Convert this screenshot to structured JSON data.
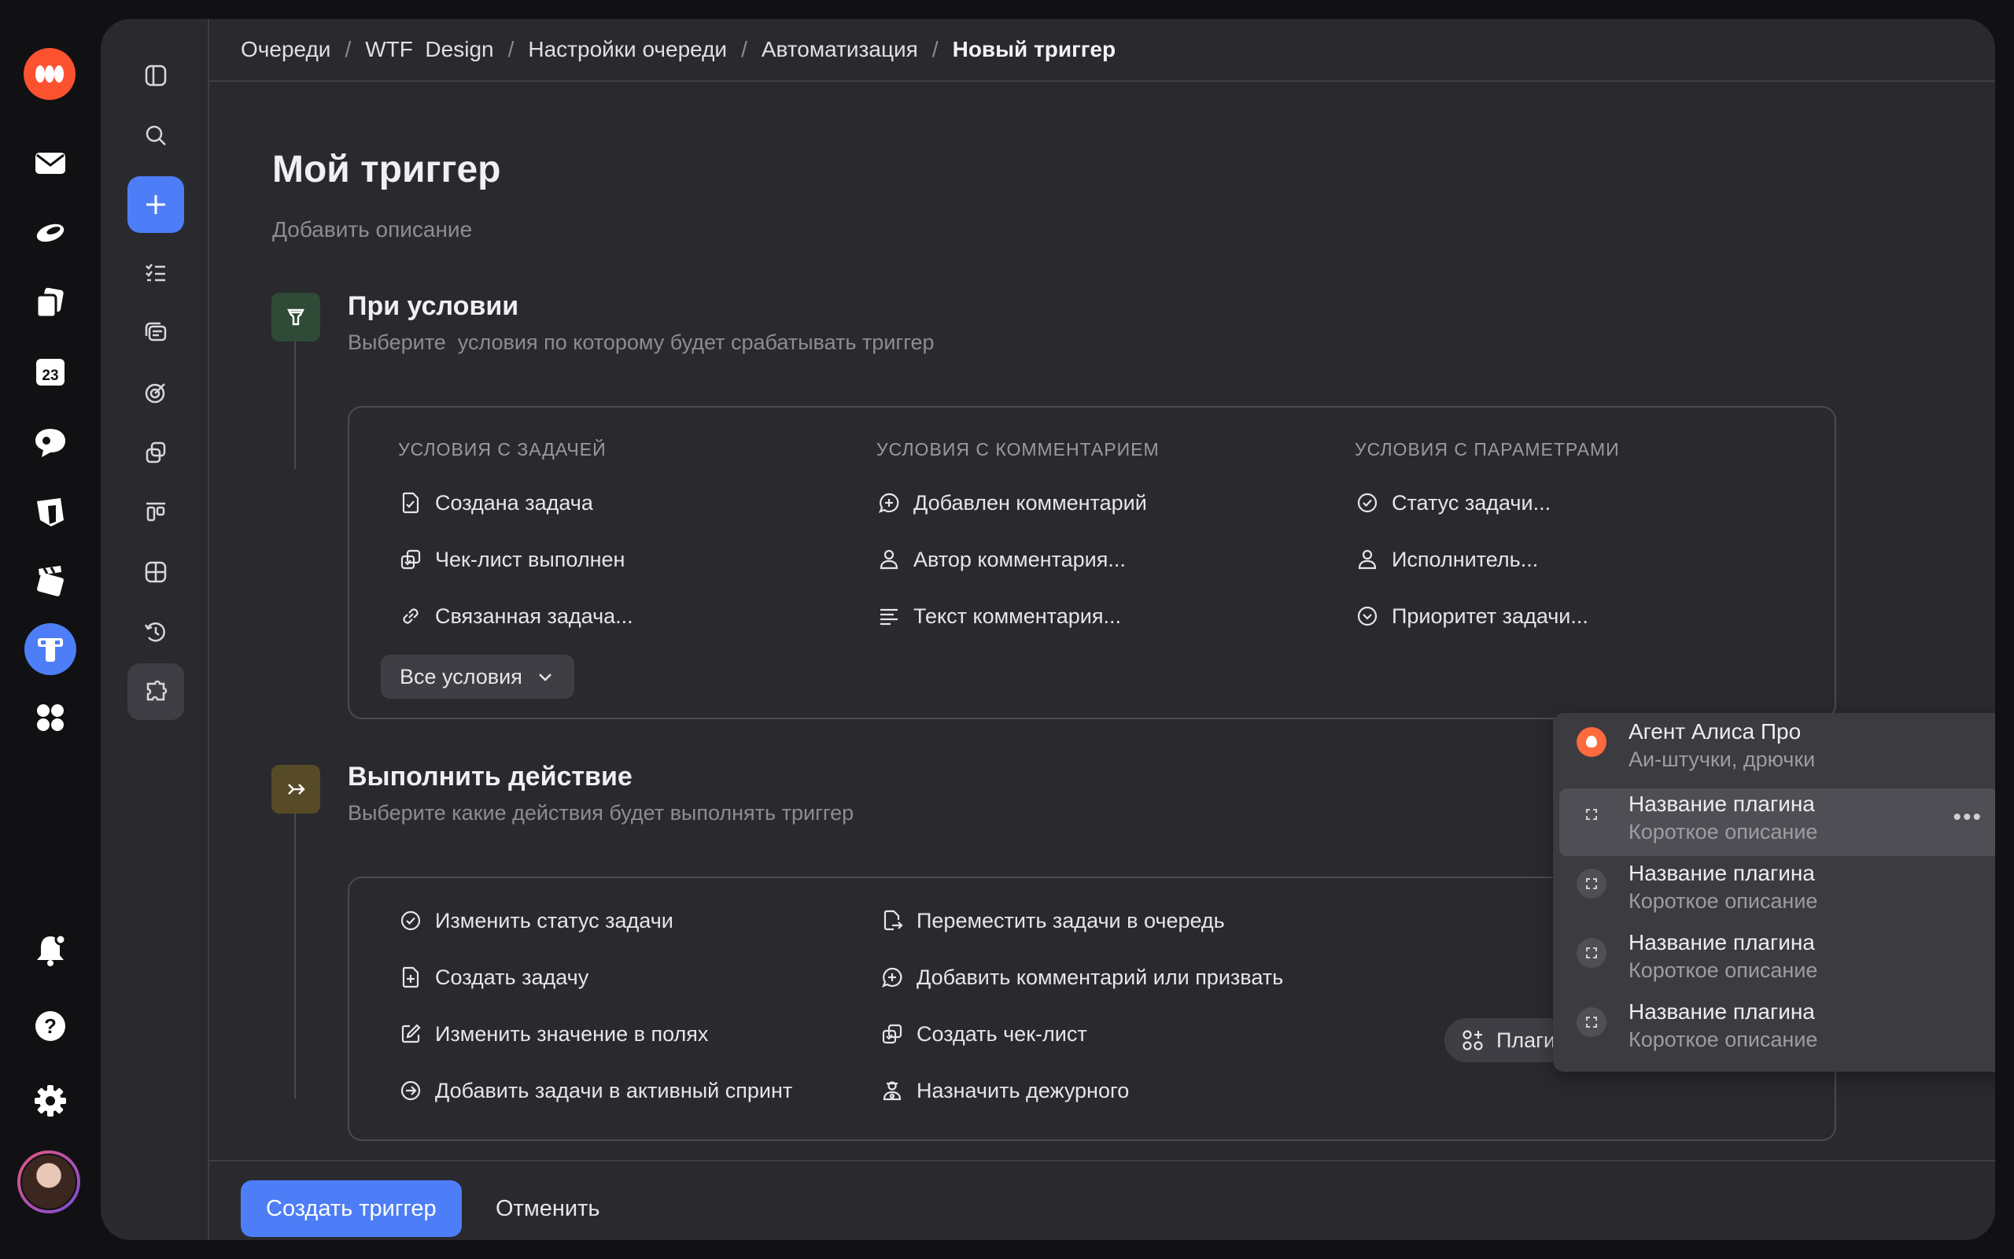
{
  "breadcrumbs": [
    "Очереди",
    "WTF  Design",
    "Настройки очереди",
    "Автоматизация",
    "Новый триггер"
  ],
  "page": {
    "title": "Мой триггер",
    "description_placeholder": "Добавить описание"
  },
  "condition_step": {
    "title": "При условии",
    "subtitle": "Выберите  условия по которому будет срабатывать триггер",
    "columns": [
      {
        "heading": "УСЛОВИЯ С ЗАДАЧЕЙ",
        "items": [
          "Создана задача",
          "Чек-лист выполнен",
          "Связанная задача..."
        ]
      },
      {
        "heading": "УСЛОВИЯ С КОММЕНТАРИЕМ",
        "items": [
          "Добавлен комментарий",
          "Автор комментария...",
          "Текст комментария..."
        ]
      },
      {
        "heading": "УСЛОВИЯ С ПАРАМЕТРАМИ",
        "items": [
          "Статус задачи...",
          "Исполнитель...",
          "Приоритет задачи..."
        ]
      }
    ],
    "all_conditions_label": "Все условия"
  },
  "action_step": {
    "title": "Выполнить действие",
    "subtitle": "Выберите какие действия будет выполнять триггер",
    "columns": [
      {
        "items": [
          "Изменить статус задачи",
          "Создать задачу",
          "Изменить значение в полях",
          "Добавить задачи в активный спринт"
        ]
      },
      {
        "items": [
          "Переместить задачи в очередь",
          "Добавить комментарий или призвать",
          "Создать чек-лист",
          "Назначить дежурного"
        ]
      }
    ],
    "plugins_label": "Плагины"
  },
  "plugins_dropdown": {
    "items": [
      {
        "title": "Агент Алиса Про",
        "subtitle": "Аи-штучки, дрючки"
      },
      {
        "title": "Название плагина",
        "subtitle": "Короткое описание"
      },
      {
        "title": "Название плагина",
        "subtitle": "Короткое описание"
      },
      {
        "title": "Название плагина",
        "subtitle": "Короткое описание"
      },
      {
        "title": "Название плагина",
        "subtitle": "Короткое описание"
      }
    ],
    "more_label": "•••"
  },
  "footer": {
    "create_label": "Создать триггер",
    "cancel_label": "Отменить"
  },
  "colors": {
    "accent": "#4d7ef7",
    "brand": "#fc5230",
    "condition_icon_bg": "#2f4a36",
    "action_icon_bg": "#574a26"
  },
  "icons": {
    "rail": [
      "logo-icon",
      "mail-icon",
      "disk-icon",
      "docs-icon",
      "calendar-icon",
      "messenger-icon",
      "notes-icon",
      "clapper-icon",
      "tracker-icon",
      "apps-icon",
      "bell-icon",
      "help-icon",
      "settings-icon"
    ],
    "sidebar": [
      "panel-toggle-icon",
      "search-icon",
      "plus-icon",
      "tasks-icon",
      "queues-icon",
      "goals-icon",
      "projects-icon",
      "boards-icon",
      "dashboards-icon",
      "history-icon",
      "plugins-icon"
    ]
  }
}
